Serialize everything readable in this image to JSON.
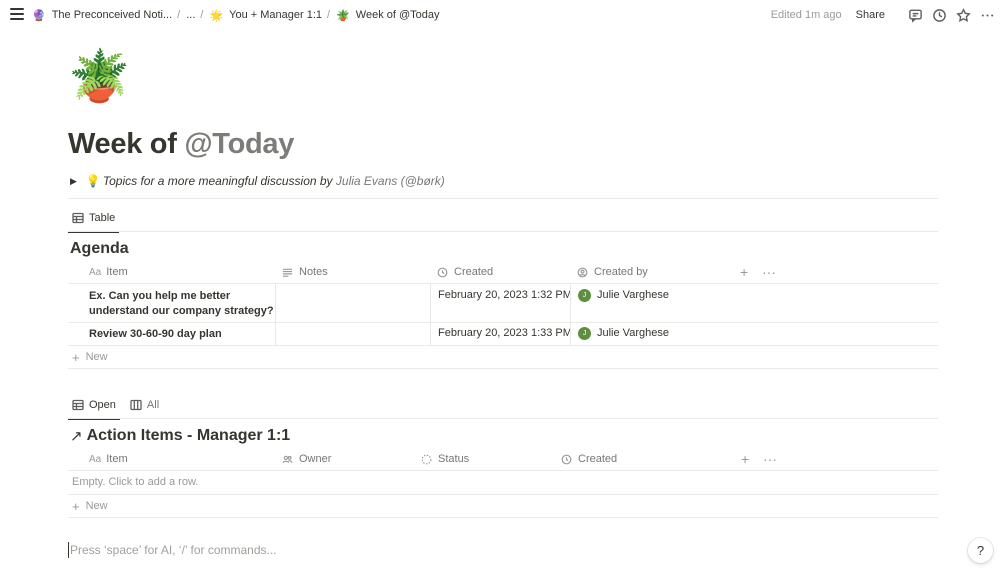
{
  "topbar": {
    "breadcrumbs": [
      {
        "emoji": "🔮",
        "label": "The Preconceived Noti..."
      },
      {
        "emoji": "",
        "label": "..."
      },
      {
        "emoji": "🌟",
        "label": "You + Manager 1:1"
      },
      {
        "emoji": "🪴",
        "label": "Week of @Today"
      }
    ],
    "edited": "Edited 1m ago",
    "share": "Share",
    "icons": [
      "comment-icon",
      "clock-icon",
      "star-icon",
      "more-icon"
    ]
  },
  "page": {
    "icon": "🪴",
    "title_prefix": "Week of ",
    "title_mention": "@Today",
    "toggle": {
      "emoji": "💡",
      "text": "Topics for a more meaningful discussion by ",
      "author": "Julia Evans (@børk)"
    },
    "prompt_placeholder": "Press ‘space’ for AI, ‘/’ for commands..."
  },
  "agenda": {
    "view_tab": "Table",
    "title": "Agenda",
    "columns": [
      "Item",
      "Notes",
      "Created",
      "Created by"
    ],
    "rows": [
      {
        "item": "Ex. Can you help me better understand our company strategy?",
        "notes": "",
        "created": "February 20, 2023 1:32 PM",
        "avatar": "J",
        "created_by": "Julie Varghese"
      },
      {
        "item": "Review 30-60-90 day plan",
        "notes": "",
        "created": "February 20, 2023 1:33 PM",
        "avatar": "J",
        "created_by": "Julie Varghese"
      }
    ],
    "new_label": "New"
  },
  "actions": {
    "tabs": [
      "Open",
      "All"
    ],
    "title": "Action Items - Manager 1:1",
    "columns": [
      "Item",
      "Owner",
      "Status",
      "Created"
    ],
    "empty_text": "Empty. Click to add a row.",
    "new_label": "New"
  },
  "help_label": "?"
}
